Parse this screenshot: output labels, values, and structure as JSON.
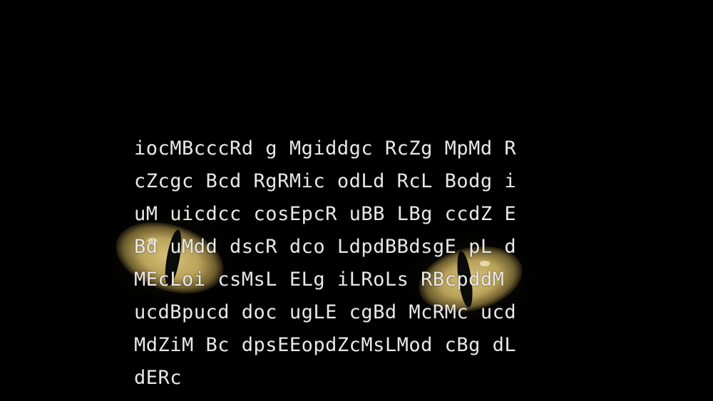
{
  "colors": {
    "background": "#000000",
    "text": "#e8e8e8",
    "iris": "#b9a25a",
    "pupil": "#0a0a08"
  },
  "image": {
    "subject": "cat-eyes-in-darkness"
  },
  "overlay_text": {
    "lines": [
      "iocMBcccRd g Mgiddgc RcZg MpMd R",
      "cZcgc Bcd RgRMic odLd RcL Bodg i",
      "uM uicdcc cosEpcR uBB LBg ccdZ E",
      "Bd uMdd dscR dco LdpdBBdsgE pL d",
      "MEcLoi csMsL ELg iLRoLs RBcpddM",
      "ucdBpucd doc ugLE cgBd McRMc ucd",
      "MdZiM Bc dpsEEopdZcMsLMod cBg dL",
      "dERc"
    ]
  }
}
